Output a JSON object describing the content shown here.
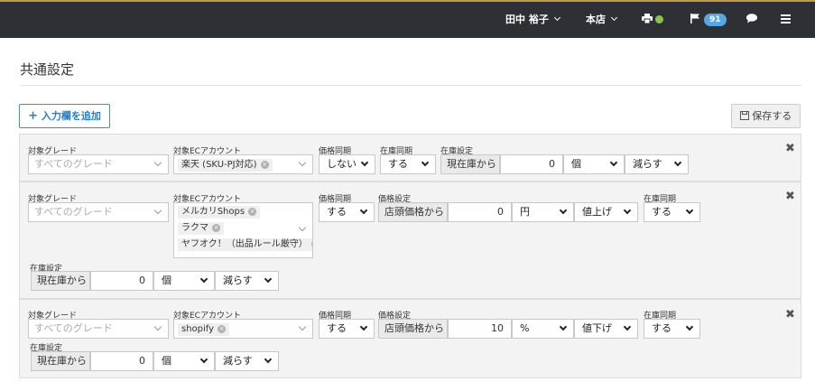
{
  "header": {
    "user_name": "田中 裕子",
    "store": "本店",
    "notification_count": "91"
  },
  "page": {
    "title": "共通設定",
    "add_button": "入力欄を追加",
    "save_button": "保存する"
  },
  "labels": {
    "grade": "対象グレード",
    "ec_account": "対象ECアカウント",
    "price_sync": "価格同期",
    "stock_sync": "在庫同期",
    "stock_setting": "在庫設定",
    "price_setting": "価格設定"
  },
  "rows": [
    {
      "grade_placeholder": "すべてのグレード",
      "accounts": [
        "楽天 (SKU-PJ対応)"
      ],
      "price_sync": "しない",
      "stock_sync": "する",
      "stock_base": "現在庫から",
      "stock_value": "0",
      "stock_unit": "個",
      "stock_direction": "減らす"
    },
    {
      "grade_placeholder": "すべてのグレード",
      "accounts": [
        "メルカリShops",
        "ラクマ",
        "ヤフオク！（出品ルール厳守）"
      ],
      "price_sync": "する",
      "price_base": "店頭価格から",
      "price_value": "0",
      "price_unit": "円",
      "price_direction": "値上げ",
      "stock_sync": "する",
      "stock_base": "現在庫から",
      "stock_value": "0",
      "stock_unit": "個",
      "stock_direction": "減らす"
    },
    {
      "grade_placeholder": "すべてのグレード",
      "accounts": [
        "shopify"
      ],
      "price_sync": "する",
      "price_base": "店頭価格から",
      "price_value": "10",
      "price_unit": "%",
      "price_direction": "値下げ",
      "stock_sync": "する",
      "stock_base": "現在庫から",
      "stock_value": "0",
      "stock_unit": "個",
      "stock_direction": "減らす"
    }
  ],
  "colors": {
    "topbar": "#2d3035",
    "accent": "#2a7ec1",
    "badge": "#5aa6e0",
    "status_ok": "#8bc34a"
  },
  "icons": [
    "chevron-down-icon",
    "printer-icon",
    "status-dot-icon",
    "flag-icon",
    "chat-icon",
    "menu-icon",
    "plus-icon",
    "save-icon",
    "close-icon",
    "remove-tag-icon"
  ]
}
